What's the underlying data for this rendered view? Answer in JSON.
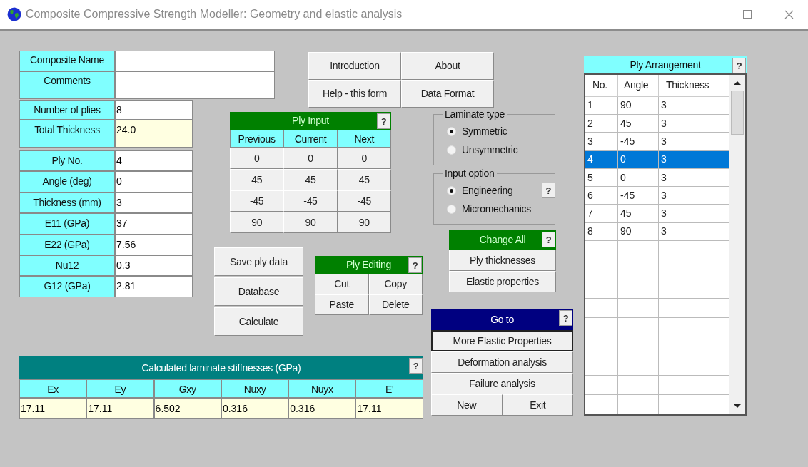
{
  "window": {
    "title": "Composite Compressive Strength Modeller: Geometry and elastic analysis"
  },
  "info_fields": [
    {
      "label": "Composite Name"
    },
    {
      "label": "Comments"
    }
  ],
  "laminate_fields": [
    {
      "label": "Number of plies",
      "value": "8",
      "kind": "input"
    },
    {
      "label": "Total Thickness",
      "value": "24.0",
      "kind": "output"
    }
  ],
  "ply_fields": [
    {
      "label": "Ply No.",
      "value": "4"
    },
    {
      "label": "Angle (deg)",
      "value": "0"
    },
    {
      "label": "Thickness (mm)",
      "value": "3"
    },
    {
      "label": "E11 (GPa)",
      "value": "37"
    },
    {
      "label": "E22 (GPa)",
      "value": "7.56"
    },
    {
      "label": "Nu12",
      "value": "0.3"
    },
    {
      "label": "G12 (GPa)",
      "value": "2.81"
    }
  ],
  "nav_buttons": [
    "Introduction",
    "About",
    "Help - this form",
    "Data Format"
  ],
  "ply_input": {
    "title": "Ply Input",
    "help": "?",
    "columns": [
      "Previous",
      "Current",
      "Next"
    ],
    "rows": [
      [
        "0",
        "0",
        "0"
      ],
      [
        "45",
        "45",
        "45"
      ],
      [
        "-45",
        "-45",
        "-45"
      ],
      [
        "90",
        "90",
        "90"
      ]
    ]
  },
  "action_buttons": [
    "Save ply data",
    "Database",
    "Calculate"
  ],
  "ply_editing": {
    "title": "Ply Editing",
    "help": "?",
    "buttons": [
      "Cut",
      "Copy",
      "Paste",
      "Delete"
    ]
  },
  "laminate_type": {
    "title": "Laminate type",
    "options": [
      {
        "label": "Symmetric",
        "selected": true
      },
      {
        "label": "Unsymmetric",
        "selected": false
      }
    ]
  },
  "input_option": {
    "title": "Input option",
    "help": "?",
    "options": [
      {
        "label": "Engineering",
        "selected": true
      },
      {
        "label": "Micromechanics",
        "selected": false
      }
    ]
  },
  "change_all": {
    "title": "Change All",
    "help": "?",
    "buttons": [
      "Ply thicknesses",
      "Elastic properties"
    ]
  },
  "go_to": {
    "title": "Go to",
    "help": "?",
    "buttons": [
      {
        "label": "More Elastic Properties",
        "focused": true
      },
      {
        "label": "Deformation analysis",
        "focused": false
      },
      {
        "label": "Failure analysis",
        "focused": false
      }
    ],
    "bottom_buttons": [
      "New",
      "Exit"
    ]
  },
  "stiffness": {
    "title": "Calculated laminate stiffnesses (GPa)",
    "help": "?",
    "columns": [
      "Ex",
      "Ey",
      "Gxy",
      "Nuxy",
      "Nuyx",
      "E'"
    ],
    "values": [
      "17.11",
      "17.11",
      "6.502",
      "0.316",
      "0.316",
      "17.11"
    ]
  },
  "ply_arrangement": {
    "title": "Ply Arrangement",
    "help": "?",
    "columns": [
      "No.",
      "Angle",
      "Thickness"
    ],
    "rows": [
      {
        "cells": [
          "1",
          "90",
          "3"
        ],
        "selected": false
      },
      {
        "cells": [
          "2",
          "45",
          "3"
        ],
        "selected": false
      },
      {
        "cells": [
          "3",
          "-45",
          "3"
        ],
        "selected": false
      },
      {
        "cells": [
          "4",
          "0",
          "3"
        ],
        "selected": true
      },
      {
        "cells": [
          "5",
          "0",
          "3"
        ],
        "selected": false
      },
      {
        "cells": [
          "6",
          "-45",
          "3"
        ],
        "selected": false
      },
      {
        "cells": [
          "7",
          "45",
          "3"
        ],
        "selected": false
      },
      {
        "cells": [
          "8",
          "90",
          "3"
        ],
        "selected": false
      }
    ]
  }
}
